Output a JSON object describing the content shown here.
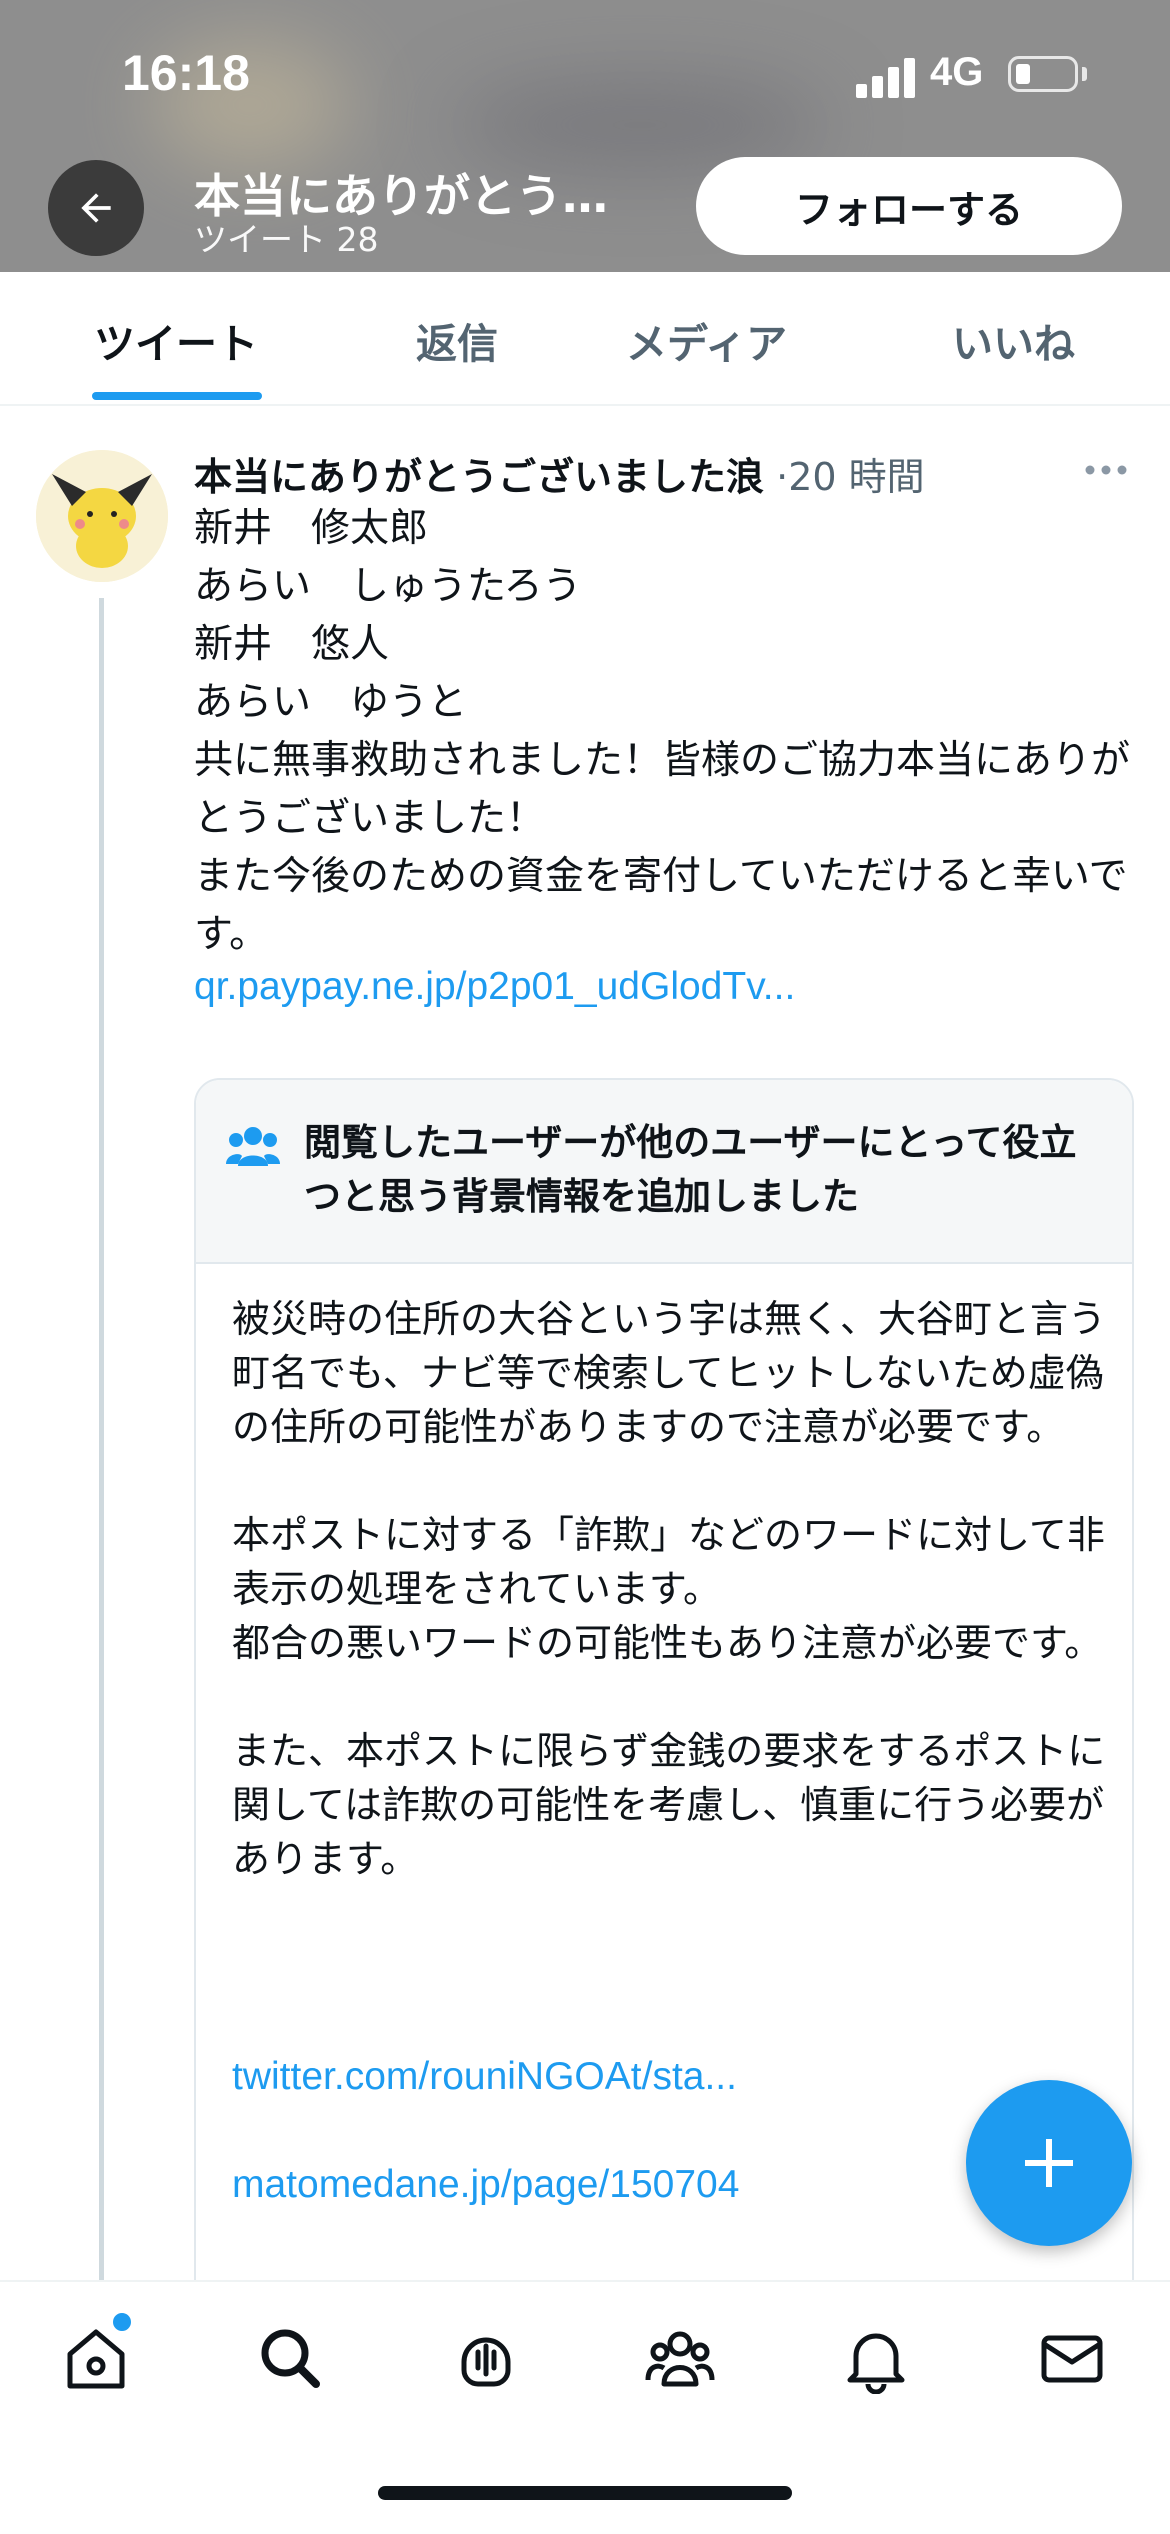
{
  "status_bar": {
    "time": "16:18",
    "network": "4G"
  },
  "header": {
    "profile_name": "本当にありがとう…",
    "tweet_count": "ツイート 28",
    "follow_label": "フォローする"
  },
  "tabs": [
    {
      "label": "ツイート",
      "active": true
    },
    {
      "label": "返信",
      "active": false
    },
    {
      "label": "メディア",
      "active": false
    },
    {
      "label": "いいね",
      "active": false
    }
  ],
  "tweet": {
    "author": "本当にありがとうございました浪",
    "time": "·20 時間",
    "text": "新井　修太郎\nあらい　しゅうたろう\n新井　悠人\nあらい　ゆうと\n共に無事救助されました！皆様のご協力本当にありがとうございました！\nまた今後のための資金を寄付していただけると幸いです。",
    "link": "qr.paypay.ne.jp/p2p01_udGlodTv..."
  },
  "note": {
    "title": "閲覧したユーザーが他のユーザーにとって役立つと思う背景情報を追加しました",
    "body": "被災時の住所の大谷という字は無く、大谷町と言う町名でも、ナビ等で検索してヒットしないため虚偽の住所の可能性がありますので注意が必要です。\n\n本ポストに対する「詐欺」などのワードに対して非表示の処理をされています。\n都合の悪いワードの可能性もあり注意が必要です。\n\nまた、本ポストに限らず金銭の要求をするポストに関しては詐欺の可能性を考慮し、慎重に行う必要があります。",
    "links": [
      "twitter.com/rouniNGOAt/sta...",
      "matomedane.jp/page/150704"
    ]
  },
  "bottom_nav": {
    "items": [
      "home-icon",
      "search-icon",
      "spaces-icon",
      "communities-icon",
      "notifications-icon",
      "messages-icon"
    ]
  },
  "colors": {
    "accent": "#1d9bf0",
    "text_primary": "#0f1419",
    "text_secondary": "#536471"
  }
}
